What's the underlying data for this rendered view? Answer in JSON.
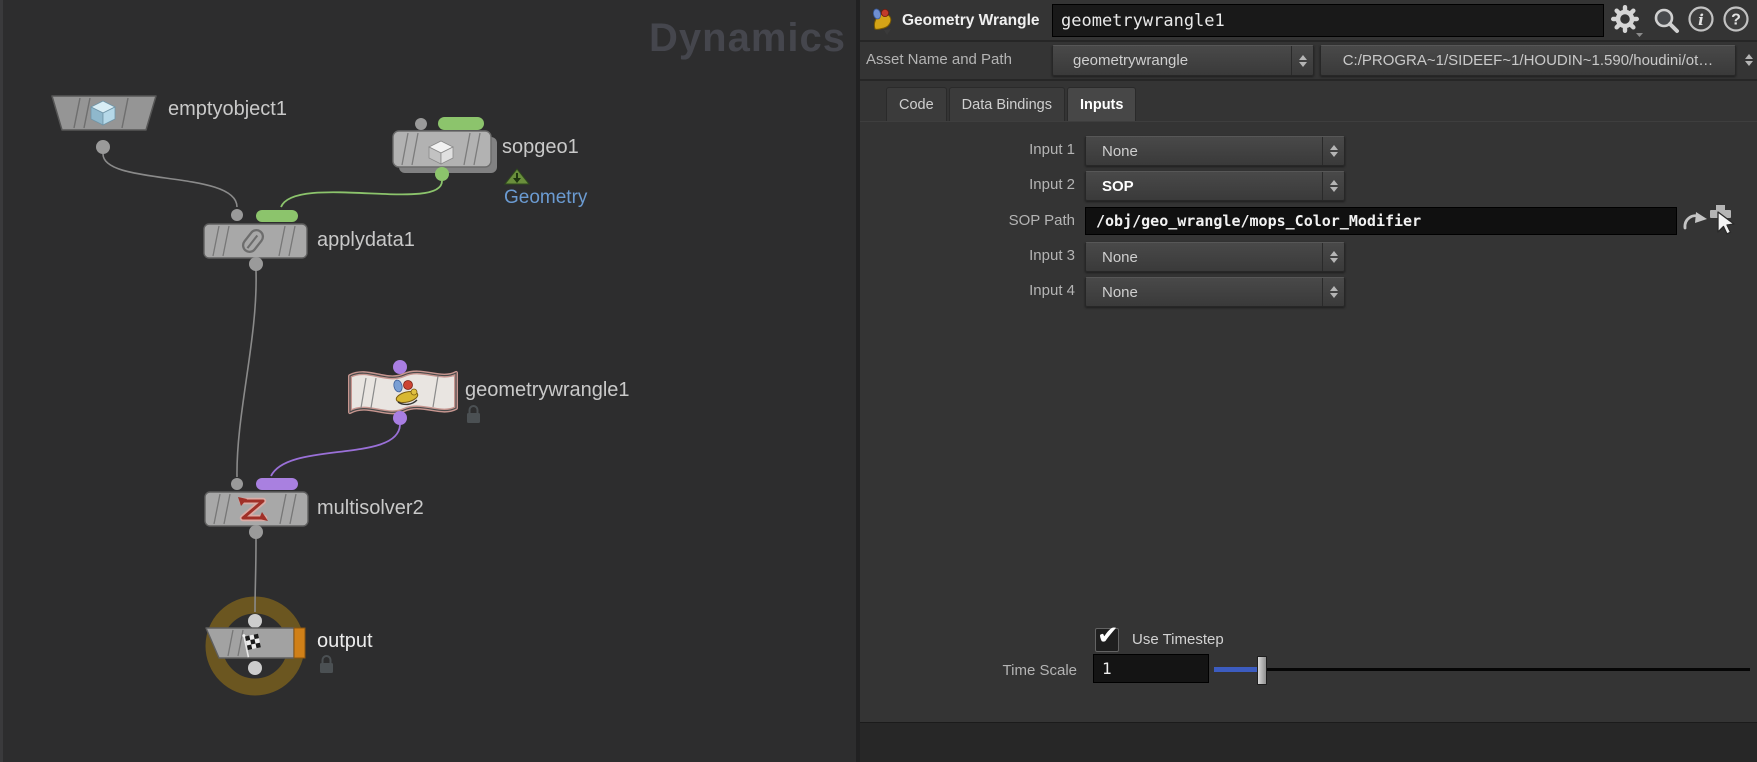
{
  "watermark": "Dynamics",
  "network": {
    "nodes": {
      "emptyobject1": {
        "label": "emptyobject1"
      },
      "sopgeo1": {
        "label": "sopgeo1",
        "output_label": "Geometry"
      },
      "applydata1": {
        "label": "applydata1"
      },
      "geometrywrangle1": {
        "label": "geometrywrangle1"
      },
      "multisolver2": {
        "label": "multisolver2"
      },
      "output": {
        "label": "output"
      }
    }
  },
  "panel": {
    "header": {
      "title": "Geometry Wrangle",
      "name_value": "geometrywrangle1",
      "icons": [
        "wrangle-node-icon",
        "gear-menu-icon",
        "search-icon",
        "info-icon",
        "help-icon"
      ]
    },
    "asset": {
      "label": "Asset Name and Path",
      "name": "geometrywrangle",
      "path": "C:/PROGRA~1/SIDEEF~1/HOUDIN~1.590/houdini/ot…"
    },
    "tabs": [
      {
        "label": "Code",
        "active": false
      },
      {
        "label": "Data Bindings",
        "active": false
      },
      {
        "label": "Inputs",
        "active": true
      }
    ],
    "inputs": {
      "input1": {
        "label": "Input 1",
        "value": "None"
      },
      "input2": {
        "label": "Input 2",
        "value": "SOP"
      },
      "sop_path": {
        "label": "SOP Path",
        "value": "/obj/geo_wrangle/mops_Color_Modifier"
      },
      "input3": {
        "label": "Input 3",
        "value": "None"
      },
      "input4": {
        "label": "Input 4",
        "value": "None"
      }
    },
    "timestep": {
      "label": "Use Timestep",
      "checked": true,
      "check_glyph": "✔"
    },
    "time_scale": {
      "label": "Time Scale",
      "value": "1"
    }
  },
  "colors": {
    "green_flag": "#8cc46c",
    "purple_flag": "#a980e0",
    "wire_purple": "#9a70d8",
    "selection_ring": "#6b5620",
    "output_flag_orange": "#d08018",
    "geometry_link_blue": "#6b9bd2",
    "slider_blue": "#3c5cc0"
  }
}
